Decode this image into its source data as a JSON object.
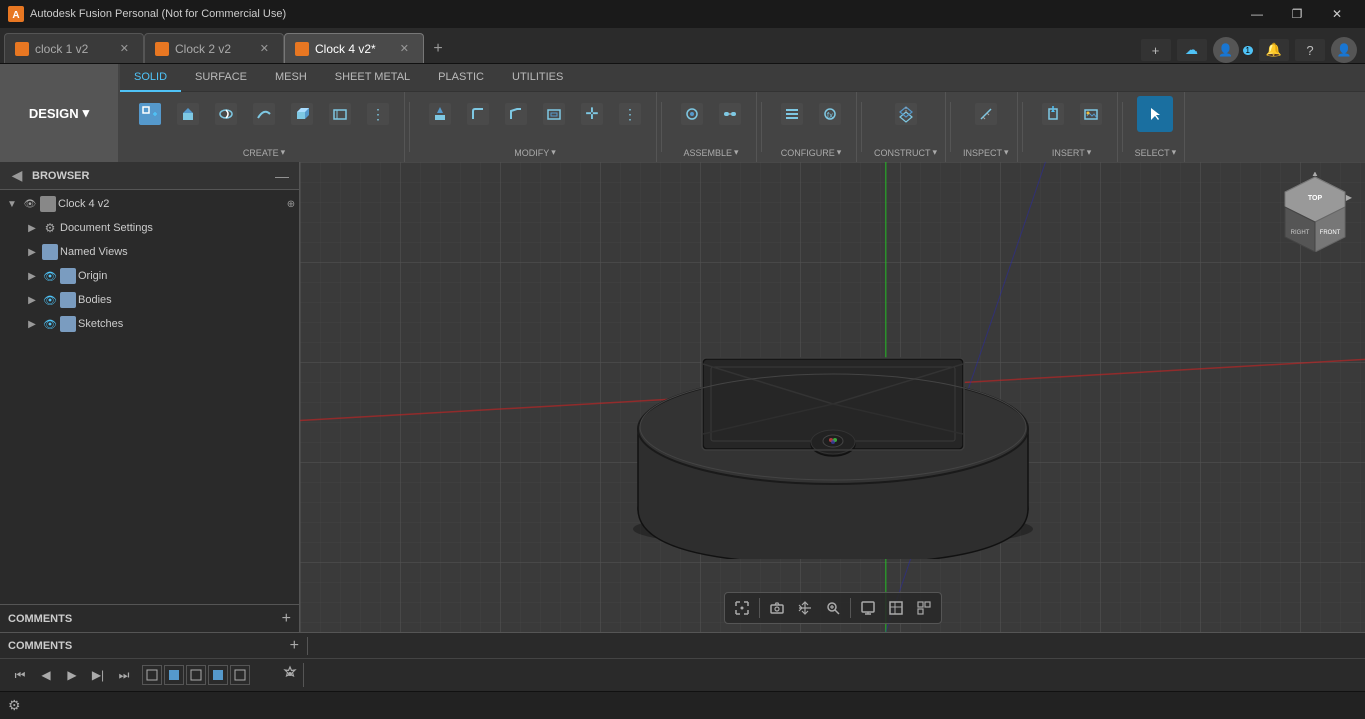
{
  "titlebar": {
    "app_name": "Autodesk Fusion Personal (Not for Commercial Use)",
    "win_minimize": "—",
    "win_maximize": "❐",
    "win_close": "✕"
  },
  "tabs": [
    {
      "id": "tab1",
      "label": "clock 1 v2",
      "icon_color": "orange",
      "active": false
    },
    {
      "id": "tab2",
      "label": "Clock 2 v2",
      "icon_color": "orange",
      "active": false
    },
    {
      "id": "tab3",
      "label": "Clock 4 v2*",
      "icon_color": "orange",
      "active": true
    }
  ],
  "tab_new_label": "+",
  "toolbar": {
    "design_label": "DESIGN",
    "design_arrow": "▾",
    "tabs": [
      "SOLID",
      "SURFACE",
      "MESH",
      "SHEET METAL",
      "PLASTIC",
      "UTILITIES"
    ],
    "active_tab": "SOLID",
    "groups": [
      {
        "id": "create",
        "label": "CREATE",
        "buttons": [
          {
            "icon": "⊕",
            "label": "",
            "title": "New Component"
          },
          {
            "icon": "⬜",
            "label": "",
            "title": "Extrude"
          },
          {
            "icon": "○",
            "label": "",
            "title": "Revolve"
          },
          {
            "icon": "⬡",
            "label": "",
            "title": "Sweep"
          },
          {
            "icon": "⊞",
            "label": "",
            "title": "Box"
          },
          {
            "icon": "◻",
            "label": "",
            "title": "Sketch"
          },
          {
            "icon": "↗",
            "label": "",
            "title": "Mirror"
          }
        ]
      },
      {
        "id": "modify",
        "label": "MODIFY",
        "buttons": [
          {
            "icon": "↻",
            "label": "",
            "title": "Press Pull"
          },
          {
            "icon": "⬟",
            "label": "",
            "title": "Fillet"
          },
          {
            "icon": "⬠",
            "label": "",
            "title": "Chamfer"
          },
          {
            "icon": "✦",
            "label": "",
            "title": "Shell"
          },
          {
            "icon": "⊠",
            "label": "",
            "title": "Move/Copy"
          },
          {
            "icon": "⊕",
            "label": "",
            "title": "Combine"
          }
        ]
      },
      {
        "id": "assemble",
        "label": "ASSEMBLE",
        "buttons": [
          {
            "icon": "⚙",
            "label": "",
            "title": "Joint"
          },
          {
            "icon": "⊞",
            "label": "",
            "title": "Motion Link"
          }
        ]
      },
      {
        "id": "configure",
        "label": "CONFIGURE",
        "buttons": [
          {
            "icon": "⊟",
            "label": "",
            "title": "Change Parameters"
          },
          {
            "icon": "⊞",
            "label": "",
            "title": "Create Rule"
          }
        ]
      },
      {
        "id": "construct",
        "label": "CONSTRUCT",
        "buttons": [
          {
            "icon": "⊘",
            "label": "",
            "title": "Offset Plane"
          }
        ]
      },
      {
        "id": "inspect",
        "label": "INSPECT",
        "buttons": [
          {
            "icon": "⊢",
            "label": "",
            "title": "Measure"
          }
        ]
      },
      {
        "id": "insert",
        "label": "INSERT",
        "buttons": [
          {
            "icon": "⊕",
            "label": "",
            "title": "Insert Derive"
          },
          {
            "icon": "🖼",
            "label": "",
            "title": "Insert Canvas"
          }
        ]
      },
      {
        "id": "select",
        "label": "SELECT",
        "active": true,
        "buttons": [
          {
            "icon": "↖",
            "label": "",
            "title": "Select"
          }
        ]
      }
    ]
  },
  "browser": {
    "title": "BROWSER",
    "collapse_icon": "—",
    "root": {
      "label": "Clock 4 v2",
      "options_icon": "⊕",
      "children": [
        {
          "label": "Document Settings",
          "icon": "gear"
        },
        {
          "label": "Named Views",
          "icon": "folder"
        },
        {
          "label": "Origin",
          "icon": "folder",
          "eye": true
        },
        {
          "label": "Bodies",
          "icon": "folder",
          "eye": true
        },
        {
          "label": "Sketches",
          "icon": "folder",
          "eye": true
        }
      ]
    }
  },
  "viewport": {
    "grid_color": "#4a4a4a"
  },
  "viewcube": {
    "top": "TOP",
    "front": "FRONT",
    "right": "RIGHT"
  },
  "comments": {
    "label": "COMMENTS",
    "add_icon": "+"
  },
  "timeline": {
    "buttons": [
      "⏮",
      "◀",
      "▶",
      "▶|",
      "⏭"
    ],
    "icon_prev_frame": "⏮",
    "icon_prev": "◀",
    "icon_play": "▶",
    "icon_next": "▶|",
    "icon_next_end": "⏭",
    "more_icon": "⊞"
  },
  "viewport_toolbar": {
    "buttons": [
      {
        "icon": "⊕",
        "title": "Fit to Screen"
      },
      {
        "icon": "📷",
        "title": "Capture"
      },
      {
        "icon": "✋",
        "title": "Pan"
      },
      {
        "icon": "🔍",
        "title": "Zoom"
      },
      {
        "icon": "⊕",
        "title": "Zoom Region"
      },
      {
        "icon": "⊟",
        "title": "Display Settings"
      },
      {
        "icon": "⊞",
        "title": "Grid"
      },
      {
        "icon": "⊟",
        "title": "Viewport"
      }
    ]
  },
  "status_bar": {
    "timeline_icons": [
      "⏮",
      "⏪",
      "▶",
      "⏩",
      "⏭"
    ],
    "animation_icons": [
      "⬜",
      "⬛",
      "⬜",
      "⬛",
      "⬜"
    ],
    "settings_icon": "⚙"
  }
}
